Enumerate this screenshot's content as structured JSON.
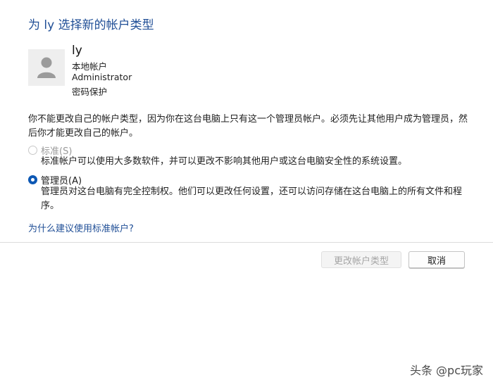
{
  "title": "为 ly 选择新的帐户类型",
  "user": {
    "name": "ly",
    "details": [
      "本地帐户",
      "Administrator",
      "密码保护"
    ]
  },
  "notice": "你不能更改自己的帐户类型，因为你在这台电脑上只有这一个管理员帐户。必须先让其他用户成为管理员，然后你才能更改自己的帐户。",
  "options": [
    {
      "label": "标准(S)",
      "description": "标准帐户可以使用大多数软件，并可以更改不影响其他用户或这台电脑安全性的系统设置。",
      "selected": false,
      "disabled": true
    },
    {
      "label": "管理员(A)",
      "description": "管理员对这台电脑有完全控制权。他们可以更改任何设置，还可以访问存储在这台电脑上的所有文件和程序。",
      "selected": true,
      "disabled": false
    }
  ],
  "help_link": "为什么建议使用标准帐户?",
  "buttons": {
    "change": "更改帐户类型",
    "change_disabled": true,
    "cancel": "取消"
  },
  "watermark": "头条 @pc玩家",
  "colors": {
    "title": "#1f4e96",
    "link": "#1f4e96",
    "radio_selected": "#0d58b4"
  },
  "icons": {
    "avatar": "user-avatar-icon"
  }
}
